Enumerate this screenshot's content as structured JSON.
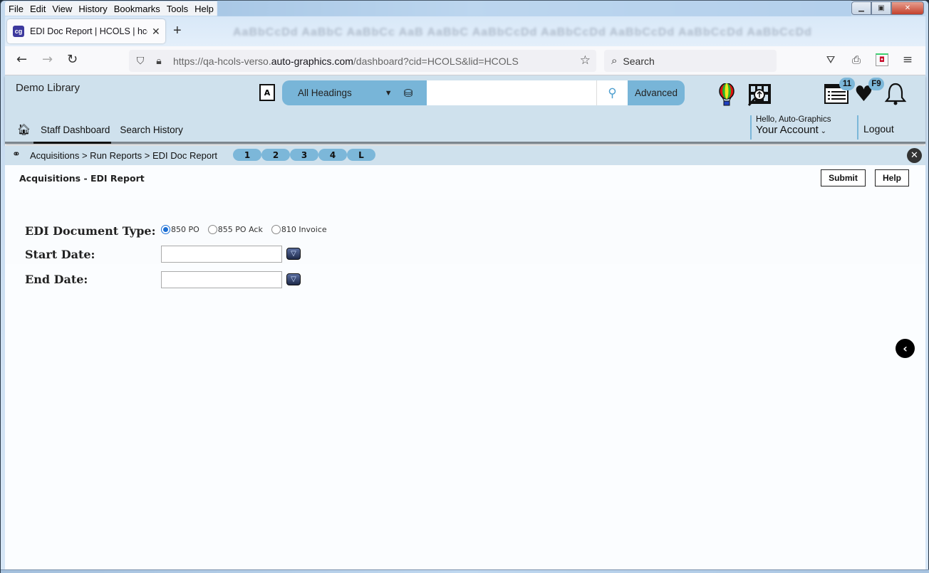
{
  "browser": {
    "menu": [
      "File",
      "Edit",
      "View",
      "History",
      "Bookmarks",
      "Tools",
      "Help"
    ],
    "tab": {
      "favicon": "cg",
      "title": "EDI Doc Report | HCOLS | hcols"
    },
    "url": {
      "prefix": "https://qa-hcols-verso.",
      "domain": "auto-graphics.com",
      "path": "/dashboard?cid=HCOLS&lid=HCOLS"
    },
    "search_placeholder": "Search"
  },
  "header": {
    "library_name": "Demo Library",
    "search": {
      "heading_select": "All Headings",
      "query": "",
      "advanced_label": "Advanced"
    },
    "badges": {
      "list_count": "11",
      "favorites": "F9"
    },
    "nav": {
      "staff_dashboard": "Staff Dashboard",
      "search_history": "Search History"
    },
    "account": {
      "greeting": "Hello, Auto-Graphics",
      "label": "Your Account",
      "logout": "Logout"
    }
  },
  "breadcrumb": {
    "items": [
      "Acquisitions",
      "Run Reports",
      "EDI Doc Report"
    ],
    "text": "Acquisitions > Run Reports > EDI Doc Report",
    "quick_tabs": [
      "1",
      "2",
      "3",
      "4",
      "L"
    ]
  },
  "page": {
    "title": "Acquisitions - EDI Report",
    "submit_label": "Submit",
    "help_label": "Help",
    "form": {
      "doc_type_label": "EDI Document Type:",
      "doc_types": [
        {
          "label": "850 PO",
          "checked": true
        },
        {
          "label": "855 PO Ack",
          "checked": false
        },
        {
          "label": "810 Invoice",
          "checked": false
        }
      ],
      "start_date_label": "Start Date:",
      "start_date_value": "",
      "end_date_label": "End Date:",
      "end_date_value": ""
    }
  }
}
